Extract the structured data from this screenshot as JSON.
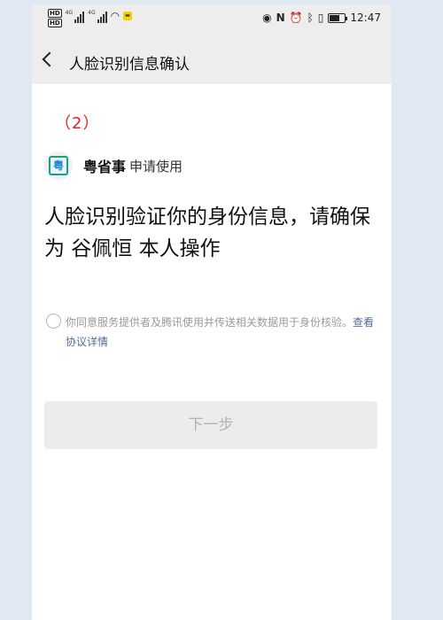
{
  "status_bar": {
    "sim1": "HD",
    "sim2": "HD",
    "network1": "4G",
    "network2": "4G",
    "time": "12:47",
    "icons": [
      "eye-icon",
      "nfc-icon",
      "alarm-icon",
      "bluetooth-icon",
      "vibrate-icon",
      "battery-icon"
    ]
  },
  "nav": {
    "back_icon": "chevron-left-icon",
    "title": "人脸识别信息确认"
  },
  "step_label": "（2）",
  "app": {
    "logo_icon": "yueshengshi-logo",
    "name": "粤省事",
    "action": "申请使用"
  },
  "message": "人脸识别验证你的身份信息，请确保为 谷佩恒 本人操作",
  "agreement": {
    "checked": false,
    "text": "你同意服务提供者及腾讯使用并传送相关数据用于身份核验。",
    "link": "查看协议详情"
  },
  "next_button": {
    "label": "下一步",
    "enabled": false
  },
  "colors": {
    "step": "#e02020",
    "link": "#546b95",
    "nav_bg": "#ededed",
    "page_bg": "#dfe8f3"
  }
}
